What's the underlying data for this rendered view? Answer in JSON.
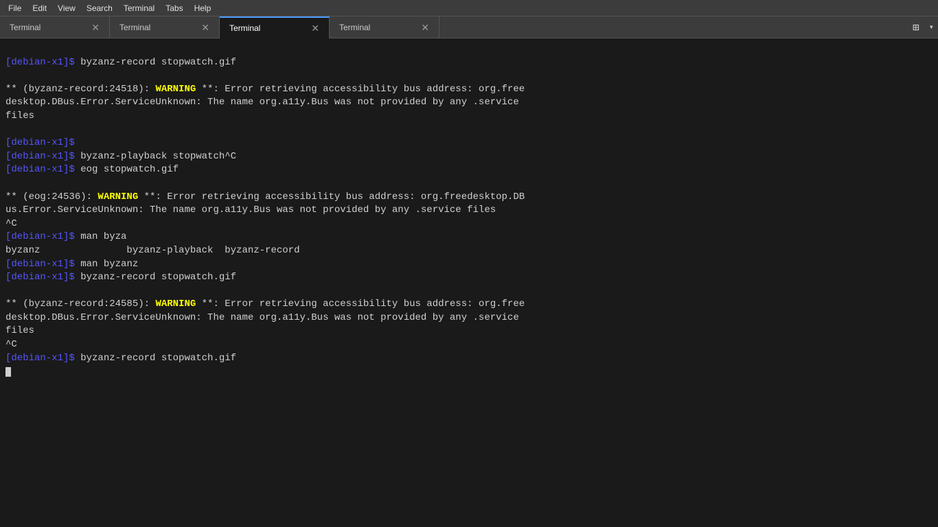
{
  "menubar": {
    "items": [
      "File",
      "Edit",
      "View",
      "Search",
      "Terminal",
      "Tabs",
      "Help"
    ]
  },
  "tabbar": {
    "tabs": [
      {
        "label": "Terminal",
        "active": false
      },
      {
        "label": "Terminal",
        "active": false
      },
      {
        "label": "Terminal",
        "active": true
      },
      {
        "label": "Terminal",
        "active": false
      }
    ]
  },
  "terminal": {
    "lines": [
      {
        "type": "prompt-cmd",
        "prompt": "[debian-x1]$",
        "cmd": " byzanz-record stopwatch.gif"
      },
      {
        "type": "blank"
      },
      {
        "type": "warning-line",
        "prefix": "** (byzanz-record:24518): ",
        "warning": "WARNING",
        "suffix": " **: Error retrieving accessibility bus address: org.free"
      },
      {
        "type": "normal",
        "text": "desktop.DBus.Error.ServiceUnknown: The name org.a11y.Bus was not provided by any .service"
      },
      {
        "type": "normal",
        "text": "files"
      },
      {
        "type": "blank"
      },
      {
        "type": "prompt-cmd",
        "prompt": "[debian-x1]$",
        "cmd": ""
      },
      {
        "type": "prompt-cmd",
        "prompt": "[debian-x1]$",
        "cmd": " byzanz-playback stopwatch^C"
      },
      {
        "type": "prompt-cmd",
        "prompt": "[debian-x1]$",
        "cmd": " eog stopwatch.gif"
      },
      {
        "type": "blank"
      },
      {
        "type": "warning-line",
        "prefix": "** (eog:24536): ",
        "warning": "WARNING",
        "suffix": " **: Error retrieving accessibility bus address: org.freedesktop.DB"
      },
      {
        "type": "normal",
        "text": "us.Error.ServiceUnknown: The name org.a11y.Bus was not provided by any .service files"
      },
      {
        "type": "normal",
        "text": "^C"
      },
      {
        "type": "prompt-cmd",
        "prompt": "[debian-x1]$",
        "cmd": " man byza"
      },
      {
        "type": "normal",
        "text": "byzanz               byzanz-playback  byzanz-record"
      },
      {
        "type": "prompt-cmd",
        "prompt": "[debian-x1]$",
        "cmd": " man byzanz"
      },
      {
        "type": "prompt-cmd",
        "prompt": "[debian-x1]$",
        "cmd": " byzanz-record stopwatch.gif"
      },
      {
        "type": "blank"
      },
      {
        "type": "warning-line",
        "prefix": "** (byzanz-record:24585): ",
        "warning": "WARNING",
        "suffix": " **: Error retrieving accessibility bus address: org.free"
      },
      {
        "type": "normal",
        "text": "desktop.DBus.Error.ServiceUnknown: The name org.a11y.Bus was not provided by any .service"
      },
      {
        "type": "normal",
        "text": "files"
      },
      {
        "type": "normal",
        "text": "^C"
      },
      {
        "type": "prompt-cmd",
        "prompt": "[debian-x1]$",
        "cmd": " byzanz-record stopwatch.gif"
      },
      {
        "type": "cursor"
      }
    ]
  }
}
